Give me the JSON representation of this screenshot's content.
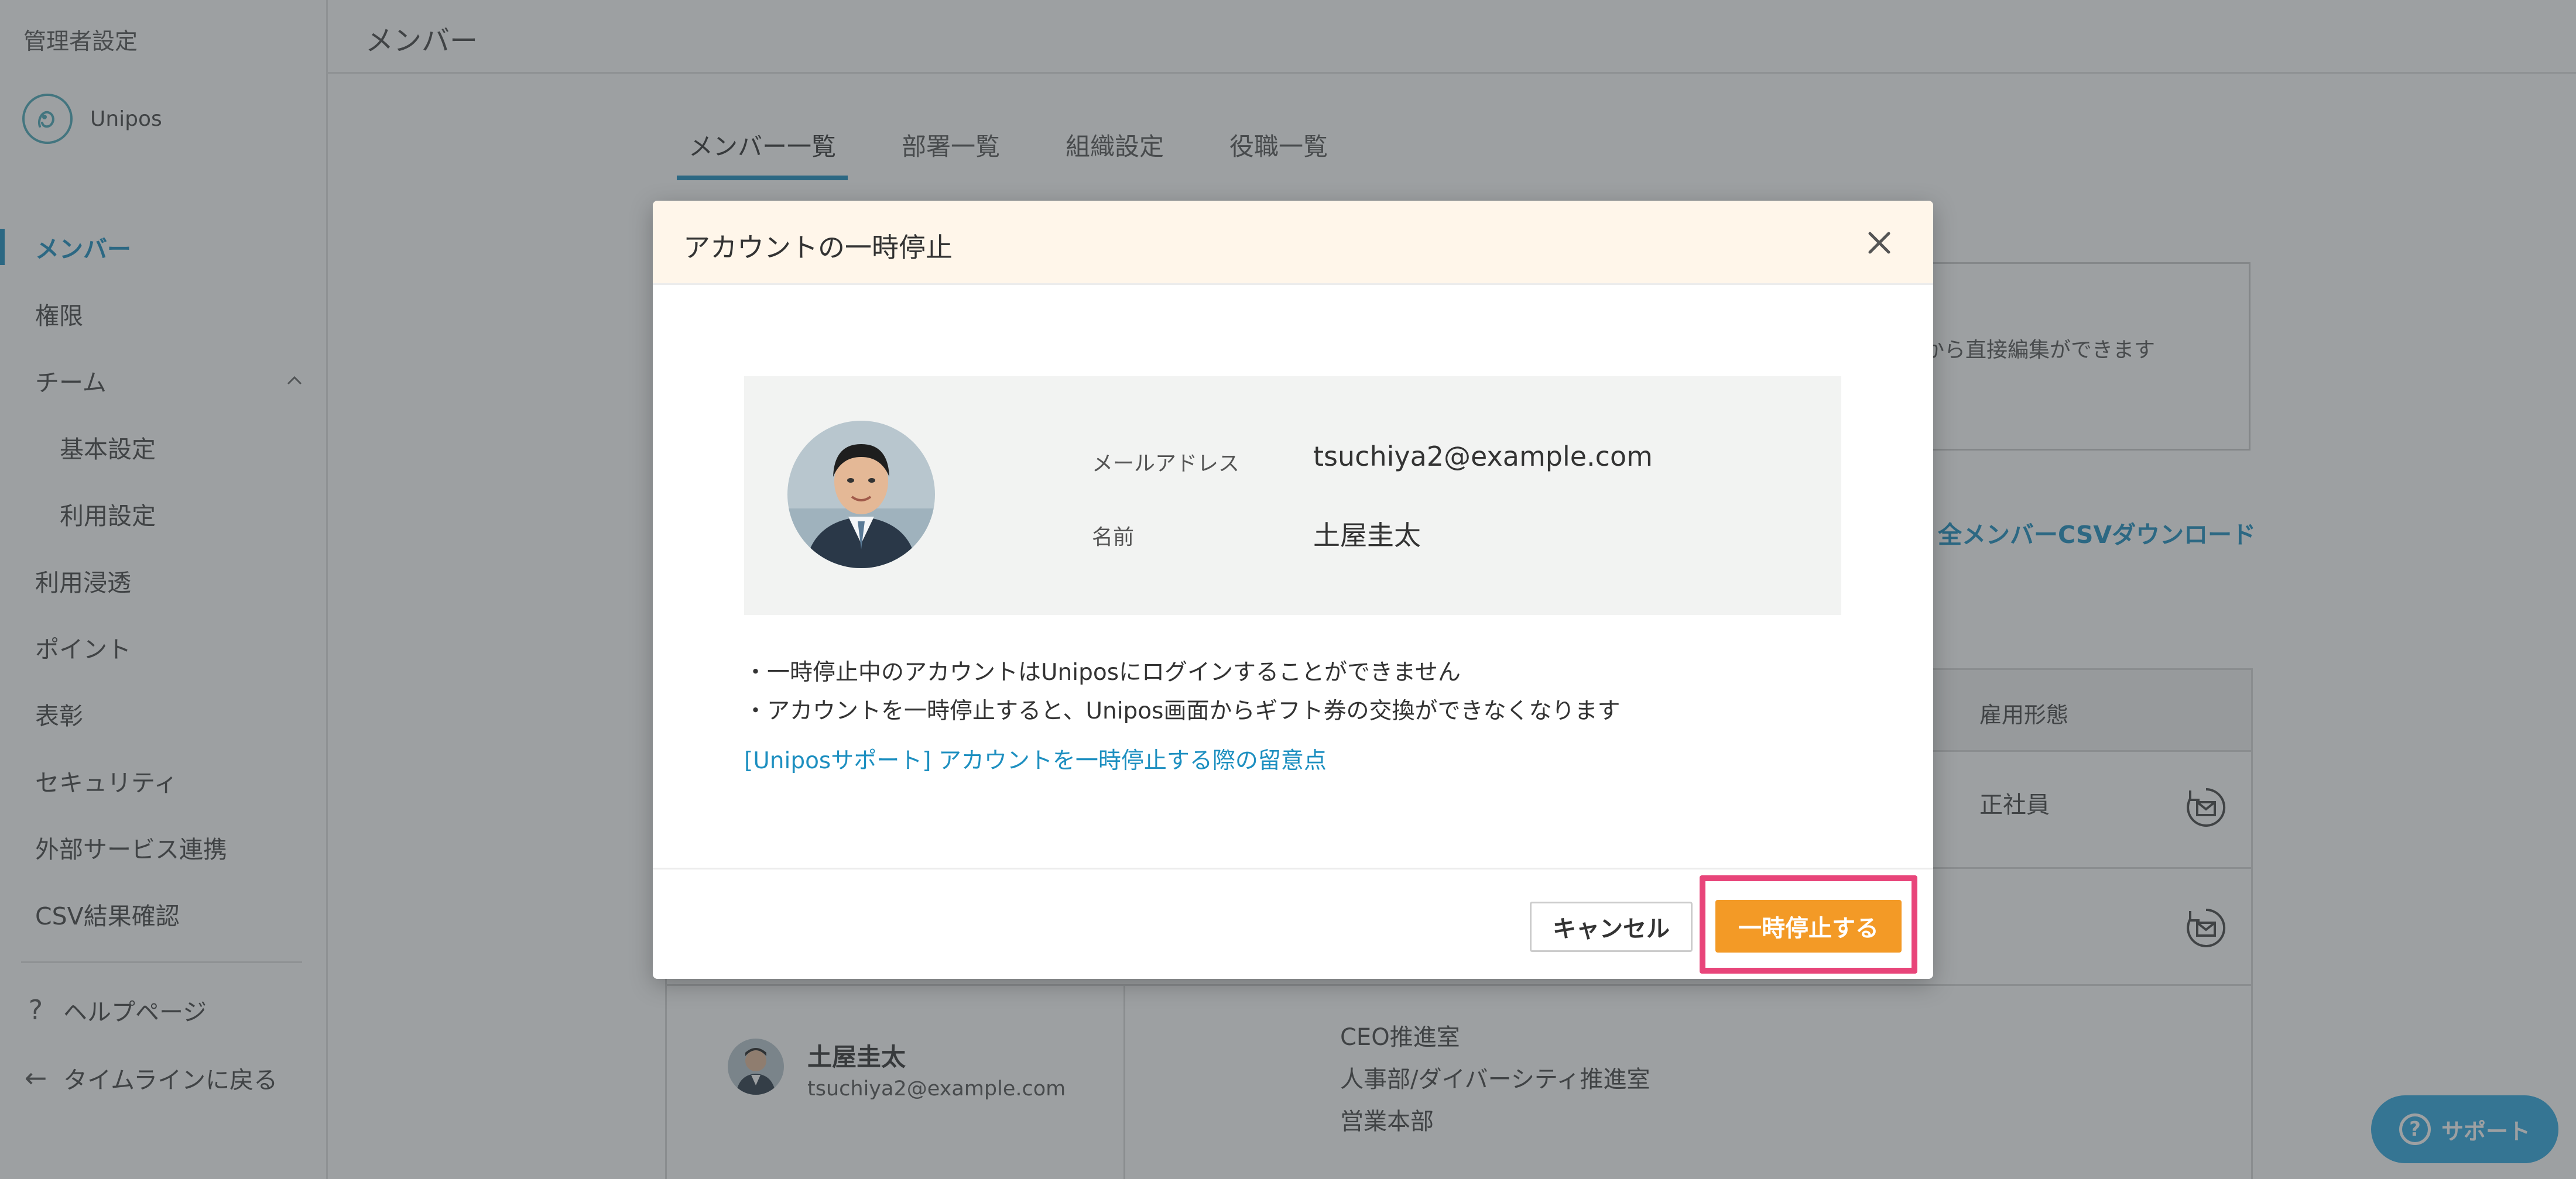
{
  "sidebar": {
    "admin_title": "管理者設定",
    "org_name": "Unipos",
    "items": [
      {
        "label": "メンバー",
        "active": true
      },
      {
        "label": "権限"
      },
      {
        "label": "チーム"
      },
      {
        "label": "基本設定"
      },
      {
        "label": "利用設定"
      },
      {
        "label": "利用浸透"
      },
      {
        "label": "ポイント"
      },
      {
        "label": "表彰"
      },
      {
        "label": "セキュリティ"
      },
      {
        "label": "外部サービス連携"
      },
      {
        "label": "CSV結果確認"
      }
    ],
    "footer": {
      "help_label": "ヘルプページ",
      "back_label": "タイムラインに戻る"
    }
  },
  "header": {
    "title": "メンバー"
  },
  "tabs": [
    {
      "label": "メンバー一覧",
      "active": true
    },
    {
      "label": "部署一覧"
    },
    {
      "label": "組織設定"
    },
    {
      "label": "役職一覧"
    }
  ],
  "info_box": {
    "hint_text": "から直接編集ができます"
  },
  "csv_download_label": "全メンバーCSVダウンロード",
  "table": {
    "column_employment": "雇用形態",
    "rows": [
      {
        "employment": "正社員"
      },
      {
        "employment": ""
      },
      {
        "name": "土屋圭太",
        "email": "tsuchiya2@example.com",
        "departments": [
          "CEO推進室",
          "人事部/ダイバーシティ推進室",
          "営業本部"
        ]
      }
    ]
  },
  "support_button": "サポート",
  "modal": {
    "title": "アカウントの一時停止",
    "email_label": "メールアドレス",
    "email_value": "tsuchiya2@example.com",
    "name_label": "名前",
    "name_value": "土屋圭太",
    "notes": [
      "・一時停止中のアカウントはUniposにログインすることができません",
      "・アカウントを一時停止すると、Unipos画面からギフト券の交換ができなくなります"
    ],
    "support_link": "[Uniposサポート] アカウントを一時停止する際の留意点",
    "cancel_label": "キャンセル",
    "confirm_label": "一時停止する"
  },
  "colors": {
    "accent": "#1d8fc0",
    "confirm_button": "#f39a26",
    "highlight_border": "#e8457a",
    "modal_header_bg": "#fff6ea",
    "support_button": "#2fa9e0"
  }
}
